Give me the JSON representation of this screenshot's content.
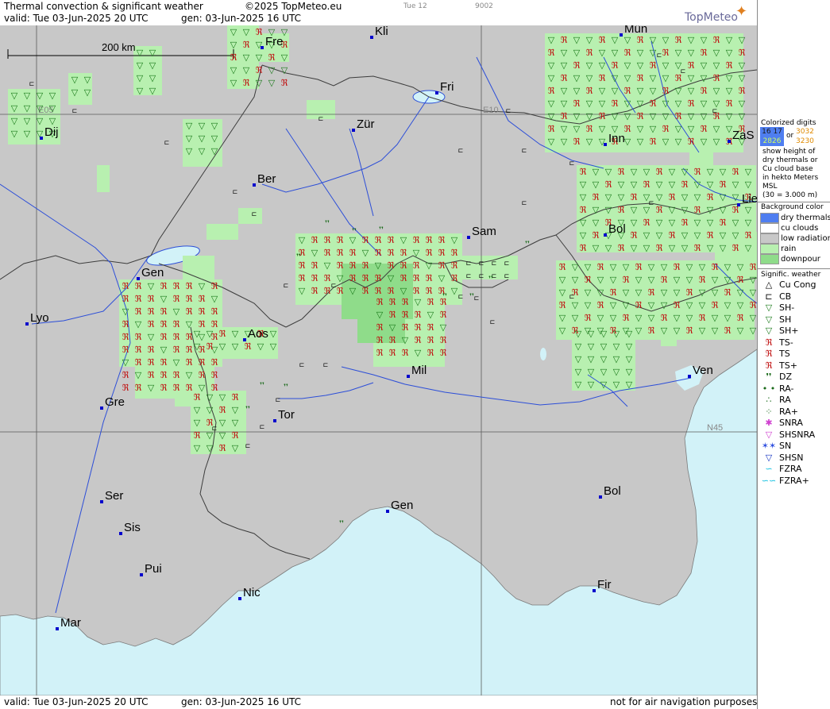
{
  "header": {
    "title": "Thermal convection & significant weather",
    "copyright": "©2025 TopMeteo.eu",
    "day_label": "Tue 12",
    "code": "9002",
    "valid_line": "valid:  Tue  03-Jun-2025  20 UTC",
    "gen_line": "gen: 03-Jun-2025 16 UTC",
    "brand": "TopMeteo"
  },
  "footer": {
    "valid_line": "valid:  Tue  03-Jun-2025  20 UTC",
    "gen_line": "gen: 03-Jun-2025 16 UTC",
    "disclaimer": "not for air navigation purposes"
  },
  "map": {
    "scale_label": "200 km",
    "grid_labels": [
      "E05",
      "E10",
      "N45"
    ],
    "cities": [
      {
        "name": "Kli"
      },
      {
        "name": "Mün"
      },
      {
        "name": "Fre"
      },
      {
        "name": "Fri"
      },
      {
        "name": "Dij"
      },
      {
        "name": "Zür"
      },
      {
        "name": "Inn"
      },
      {
        "name": "ZaS"
      },
      {
        "name": "Ber"
      },
      {
        "name": "Lie"
      },
      {
        "name": "Sam"
      },
      {
        "name": "Bol"
      },
      {
        "name": "Gen"
      },
      {
        "name": "Lyo"
      },
      {
        "name": "Aos"
      },
      {
        "name": "Mil"
      },
      {
        "name": "Ven"
      },
      {
        "name": "Gre"
      },
      {
        "name": "Tor"
      },
      {
        "name": "Ser"
      },
      {
        "name": "Gen"
      },
      {
        "name": "Bol"
      },
      {
        "name": "Sis"
      },
      {
        "name": "Pui"
      },
      {
        "name": "Nic"
      },
      {
        "name": "Fir"
      },
      {
        "name": "Mar"
      }
    ],
    "colors": {
      "land": "#c8c8c8",
      "sea": "#d2f2f8",
      "rain": "#b8f0b0",
      "downpour": "#9be296",
      "border": "#3c3c3c",
      "river": "#2c4ed8",
      "city": "#0000cc"
    }
  },
  "legend": {
    "colorized_title": [
      "Colorized digits",
      "shown height of"
    ],
    "digits_a": [
      "16",
      "17"
    ],
    "digits_b": [
      "28",
      "26"
    ],
    "digits_or": "or",
    "digits_c": [
      "30",
      "32"
    ],
    "digits_d": [
      "32",
      "30"
    ],
    "description": [
      "show height of",
      "dry thermals or",
      "Cu cloud base",
      "in hekto Meters",
      "MSL",
      "(30 = 3.000 m)"
    ],
    "bg_title": "Background color",
    "bg_items": [
      {
        "label": "dry thermals",
        "color": "#4f7ef0"
      },
      {
        "label": "cu clouds",
        "color": "#ffffff"
      },
      {
        "label": "low radiation",
        "color": "#c8c8c8"
      },
      {
        "label": "rain",
        "color": "#b8f0b0"
      },
      {
        "label": "downpour",
        "color": "#8fdc8a"
      }
    ],
    "wx_title": "Signific. weather",
    "wx_items": [
      {
        "label": "Cu Cong",
        "icon": "△",
        "color": "#000"
      },
      {
        "label": "CB",
        "icon": "⊏",
        "color": "#000"
      },
      {
        "label": "SH-",
        "icon": "▽",
        "color": "#1a7a1a"
      },
      {
        "label": "SH",
        "icon": "▽",
        "color": "#1a7a1a"
      },
      {
        "label": "SH+",
        "icon": "▽",
        "color": "#1a7a1a"
      },
      {
        "label": "TS-",
        "icon": "ℜ",
        "color": "#c01010"
      },
      {
        "label": "TS",
        "icon": "ℜ",
        "color": "#c01010"
      },
      {
        "label": "TS+",
        "icon": "ℜ",
        "color": "#c01010"
      },
      {
        "label": "DZ",
        "icon": "❜❜",
        "color": "#1a6a1a"
      },
      {
        "label": "RA-",
        "icon": "• •",
        "color": "#1a6a1a"
      },
      {
        "label": "RA",
        "icon": "∴",
        "color": "#1a6a1a"
      },
      {
        "label": "RA+",
        "icon": "⁘",
        "color": "#1a6a1a"
      },
      {
        "label": "SNRA",
        "icon": "✱",
        "color": "#d040d0"
      },
      {
        "label": "SHSNRA",
        "icon": "▽",
        "color": "#d040d0"
      },
      {
        "label": "SN",
        "icon": "✶✶",
        "color": "#3050e0"
      },
      {
        "label": "SHSN",
        "icon": "▽",
        "color": "#1030c0"
      },
      {
        "label": "FZRA",
        "icon": "∽",
        "color": "#10c0e0"
      },
      {
        "label": "FZRA+",
        "icon": "∽∽",
        "color": "#10c0e0"
      }
    ]
  }
}
